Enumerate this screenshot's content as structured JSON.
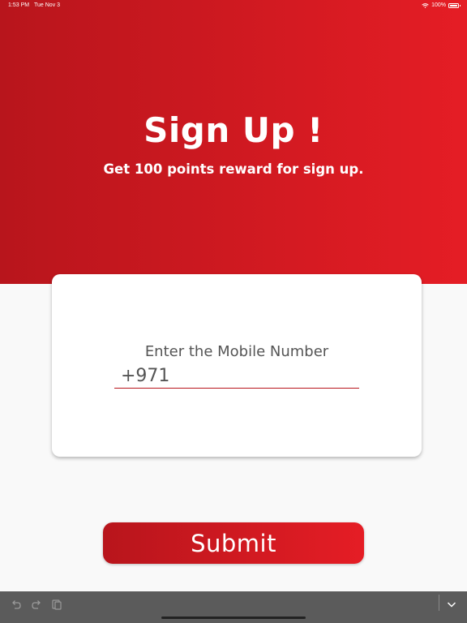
{
  "status": {
    "time": "1:53 PM",
    "date": "Tue Nov 3",
    "battery": "100%"
  },
  "header": {
    "title": "Sign Up !",
    "subtitle": "Get 100 points reward for sign up."
  },
  "form": {
    "label": "Enter the Mobile Number",
    "phone_value": "+971"
  },
  "submit_label": "Submit",
  "toolbar": {
    "undo": "undo-icon",
    "redo": "redo-icon",
    "paste": "paste-icon",
    "collapse": "chevron-down-icon"
  },
  "colors": {
    "brand_dark": "#b8151c",
    "brand_light": "#e51d25",
    "background": "#f9f9f9",
    "toolbar": "#5b5b5b"
  }
}
